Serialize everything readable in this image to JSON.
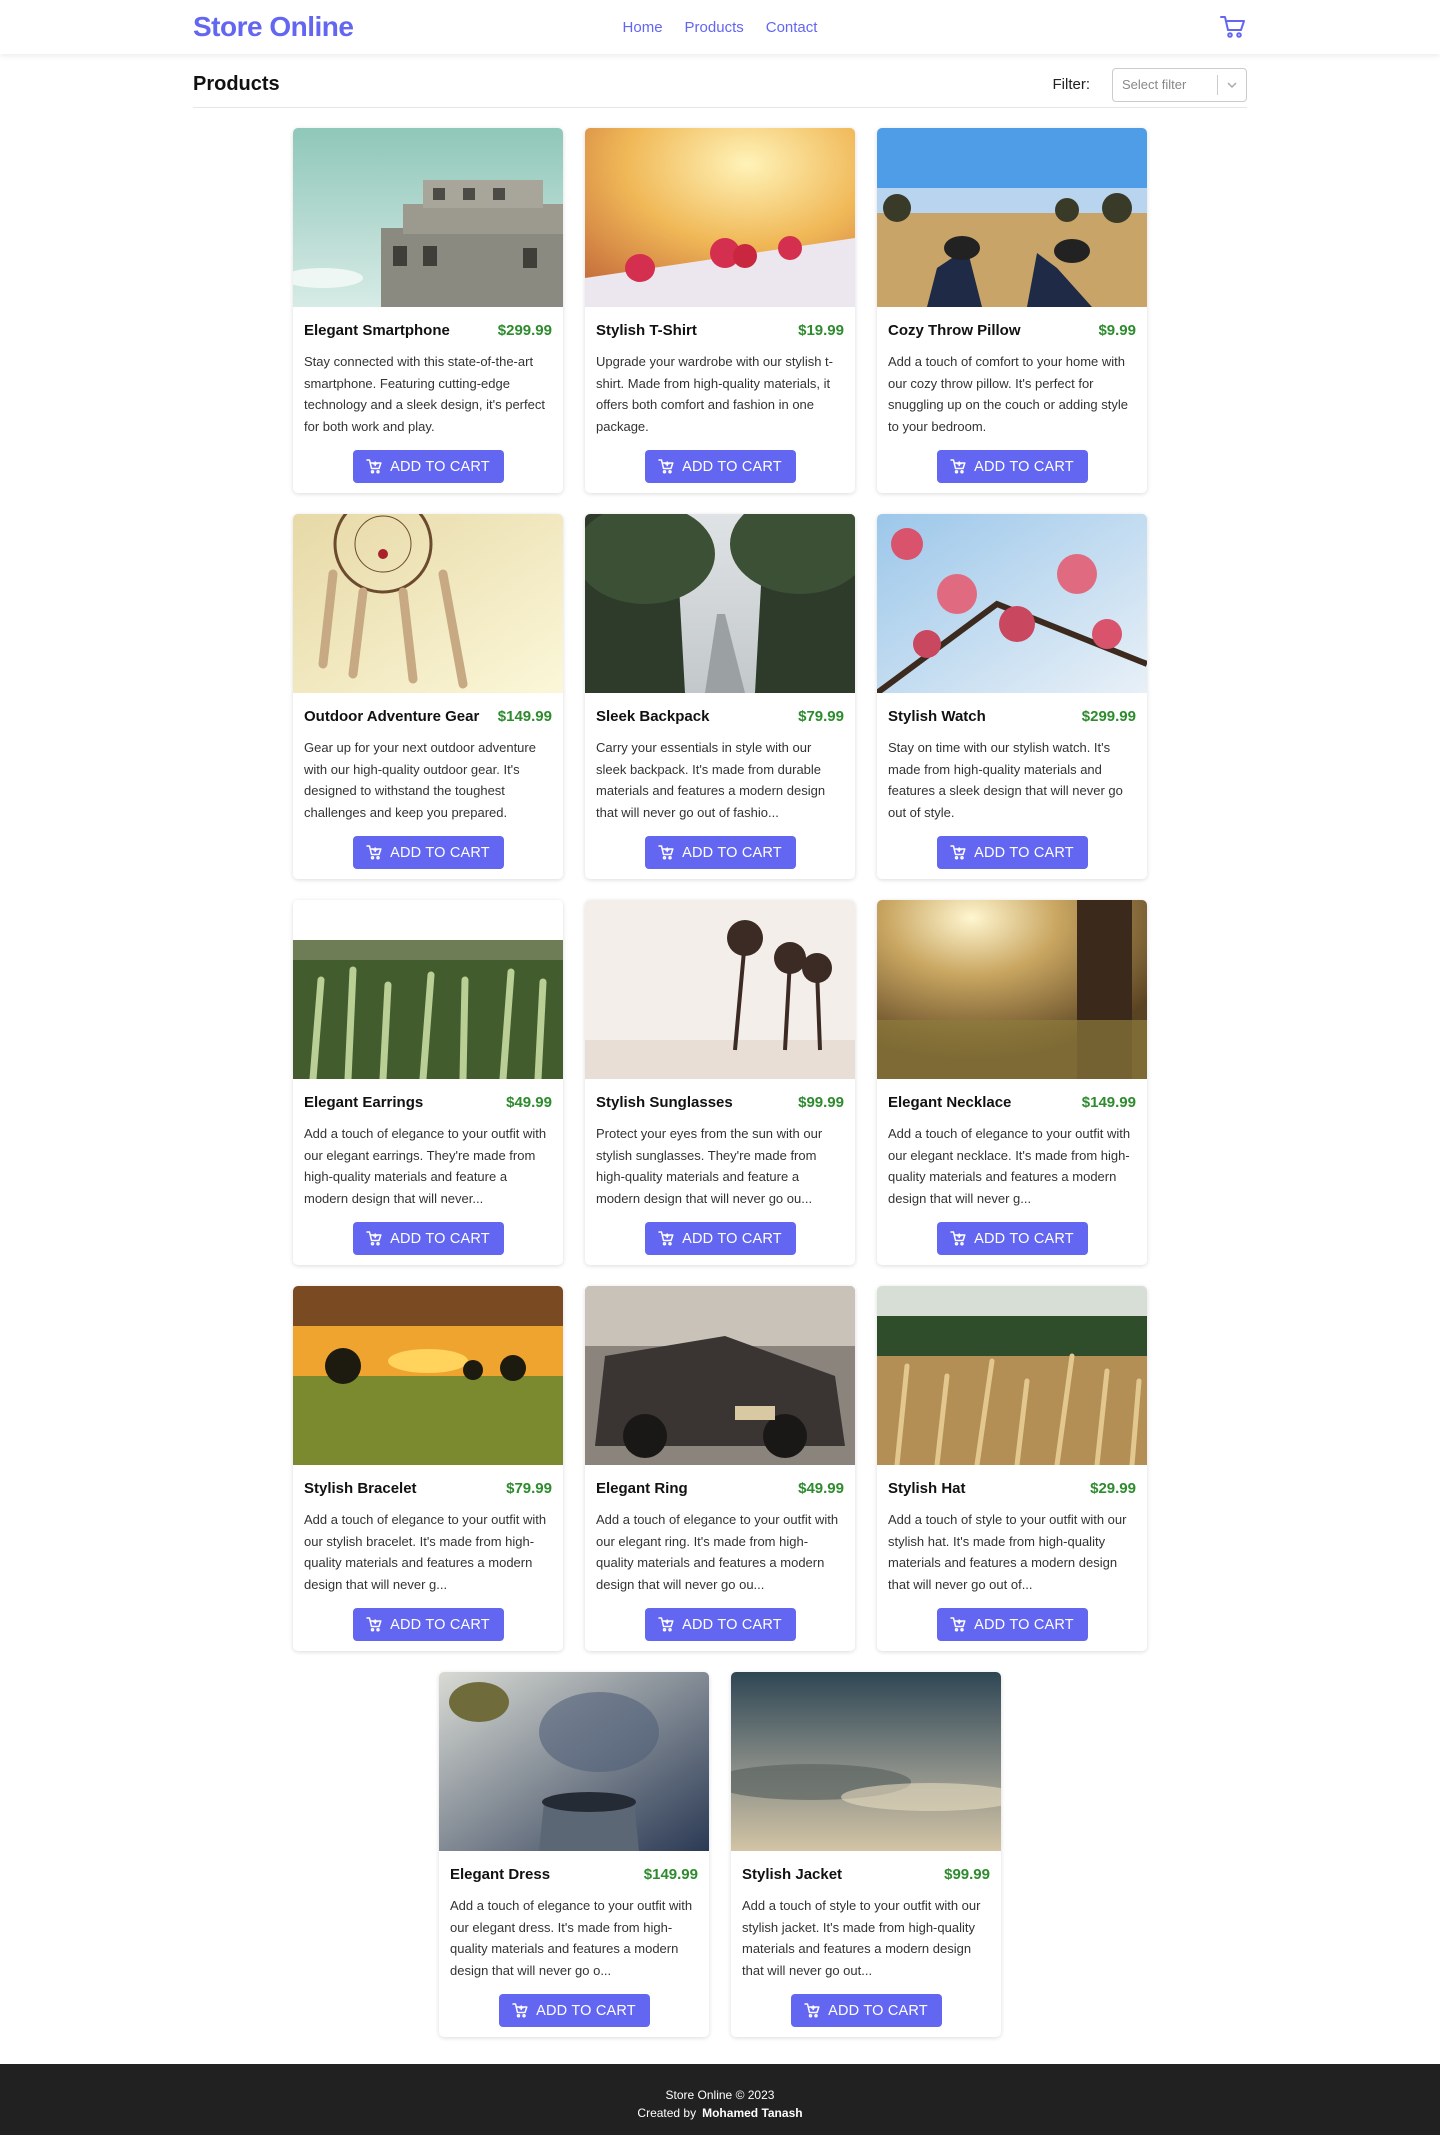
{
  "brand": "Store Online",
  "nav": [
    "Home",
    "Products",
    "Contact"
  ],
  "page_title": "Products",
  "filter": {
    "label": "Filter:",
    "placeholder": "Select filter"
  },
  "button_label": "ADD TO CART",
  "products": [
    {
      "name": "Elegant Smartphone",
      "price": "$299.99",
      "desc": "Stay connected with this state-of-the-art smartphone. Featuring cutting-edge technology and a sleek design, it's perfect for both work and play.",
      "image": "concrete-tower-photo"
    },
    {
      "name": "Stylish T-Shirt",
      "price": "$19.99",
      "desc": "Upgrade your wardrobe with our stylish t-shirt. Made from high-quality materials, it offers both comfort and fashion in one package.",
      "image": "raspberries-photo"
    },
    {
      "name": "Cozy Throw Pillow",
      "price": "$9.99",
      "desc": "Add a touch of comfort to your home with our cozy throw pillow. It's perfect for snuggling up on the couch or adding style to your bedroom.",
      "image": "sneakers-field-photo"
    },
    {
      "name": "Outdoor Adventure Gear",
      "price": "$149.99",
      "desc": "Gear up for your next outdoor adventure with our high-quality outdoor gear. It's designed to withstand the toughest challenges and keep you prepared.",
      "image": "dreamcatcher-photo"
    },
    {
      "name": "Sleek Backpack",
      "price": "$79.99",
      "desc": "Carry your essentials in style with our sleek backpack. It's made from durable materials and features a modern design that will never go out of fashio...",
      "image": "foggy-road-photo"
    },
    {
      "name": "Stylish Watch",
      "price": "$299.99",
      "desc": "Stay on time with our stylish watch. It's made from high-quality materials and features a sleek design that will never go out of style.",
      "image": "pink-blossoms-photo"
    },
    {
      "name": "Elegant Earrings",
      "price": "$49.99",
      "desc": "Add a touch of elegance to your outfit with our elegant earrings. They're made from high-quality materials and feature a modern design that will never...",
      "image": "wheat-field-photo"
    },
    {
      "name": "Stylish Sunglasses",
      "price": "$99.99",
      "desc": "Protect your eyes from the sun with our stylish sunglasses. They're made from high-quality materials and feature a modern design that will never go ou...",
      "image": "palm-trees-photo"
    },
    {
      "name": "Elegant Necklace",
      "price": "$149.99",
      "desc": "Add a touch of elegance to your outfit with our elegant necklace. It's made from high-quality materials and features a modern design that will never g...",
      "image": "sunlit-meadow-photo"
    },
    {
      "name": "Stylish Bracelet",
      "price": "$79.99",
      "desc": "Add a touch of elegance to your outfit with our stylish bracelet. It's made from high-quality materials and features a modern design that will never g...",
      "image": "sunset-trees-photo"
    },
    {
      "name": "Elegant Ring",
      "price": "$49.99",
      "desc": "Add a touch of elegance to your outfit with our elegant ring. It's made from high-quality materials and features a modern design that will never go ou...",
      "image": "vintage-car-photo"
    },
    {
      "name": "Stylish Hat",
      "price": "$29.99",
      "desc": "Add a touch of style to your outfit with our stylish hat. It's made from high-quality materials and features a modern design that will never go out of...",
      "image": "golden-grass-photo"
    },
    {
      "name": "Elegant Dress",
      "price": "$149.99",
      "desc": "Add a touch of elegance to your outfit with our elegant dress. It's made from high-quality materials and features a modern design that will never go o...",
      "image": "steaming-cup-photo"
    },
    {
      "name": "Stylish Jacket",
      "price": "$99.99",
      "desc": "Add a touch of style to your outfit with our stylish jacket. It's made from high-quality materials and features a modern design that will never go out...",
      "image": "cloudy-sky-photo"
    }
  ],
  "footer": {
    "copyright": "Store Online © 2023",
    "created_by": "Created by",
    "author": "Mohamed Tanash"
  },
  "colors": {
    "accent": "#6366f1",
    "price": "#2e8b2e",
    "footer_bg": "#212121"
  }
}
